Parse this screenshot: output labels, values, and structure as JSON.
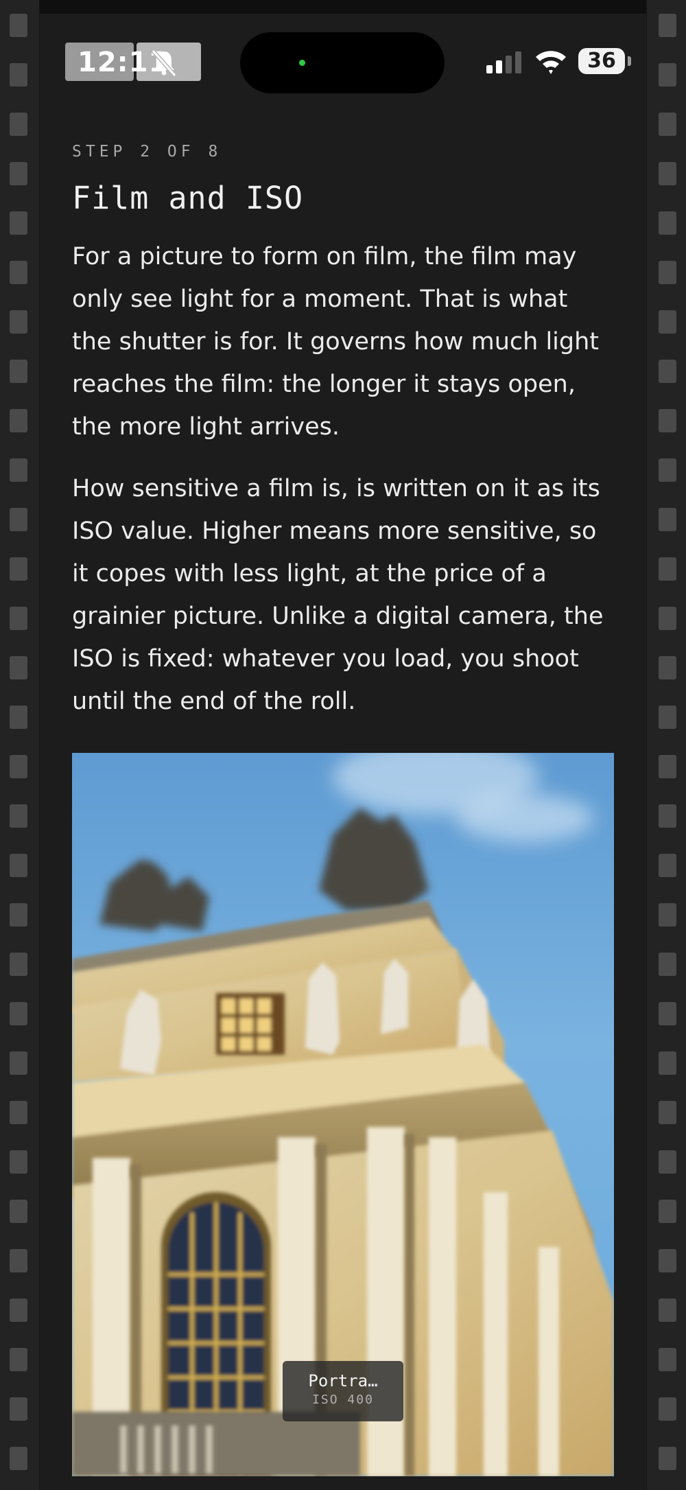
{
  "status_bar": {
    "time": "12:11",
    "battery_percent": "36",
    "signal_bars_active": 2,
    "signal_bars_total": 4,
    "icons": [
      "bell-slash-icon",
      "signal-icon",
      "wifi-icon",
      "battery-icon"
    ],
    "island_indicator_color": "#2ecc40"
  },
  "lesson": {
    "step_label": "STEP 2 OF 8",
    "title": "Film and ISO",
    "paragraphs": [
      "For a picture to form on film, the film may only see light for a moment. That is what the shutter is for. It governs how much light reaches the film: the longer it stays open, the more light arrives.",
      "How sensitive a film is, is written on it as its ISO value. Higher means more sensitive, so it copes with less light, at the price of a grainier picture. Unlike a digital camera, the ISO is fixed: whatever you load, you shoot until the end of the roll."
    ]
  },
  "film": {
    "name": "Portra…",
    "iso_label": "ISO 400"
  },
  "colors": {
    "background": "#1c1c1c",
    "film_rail": "#232323",
    "perforation": "#4a4a4a",
    "sky": "#6aa5d8",
    "stone": "#d9c79a"
  }
}
